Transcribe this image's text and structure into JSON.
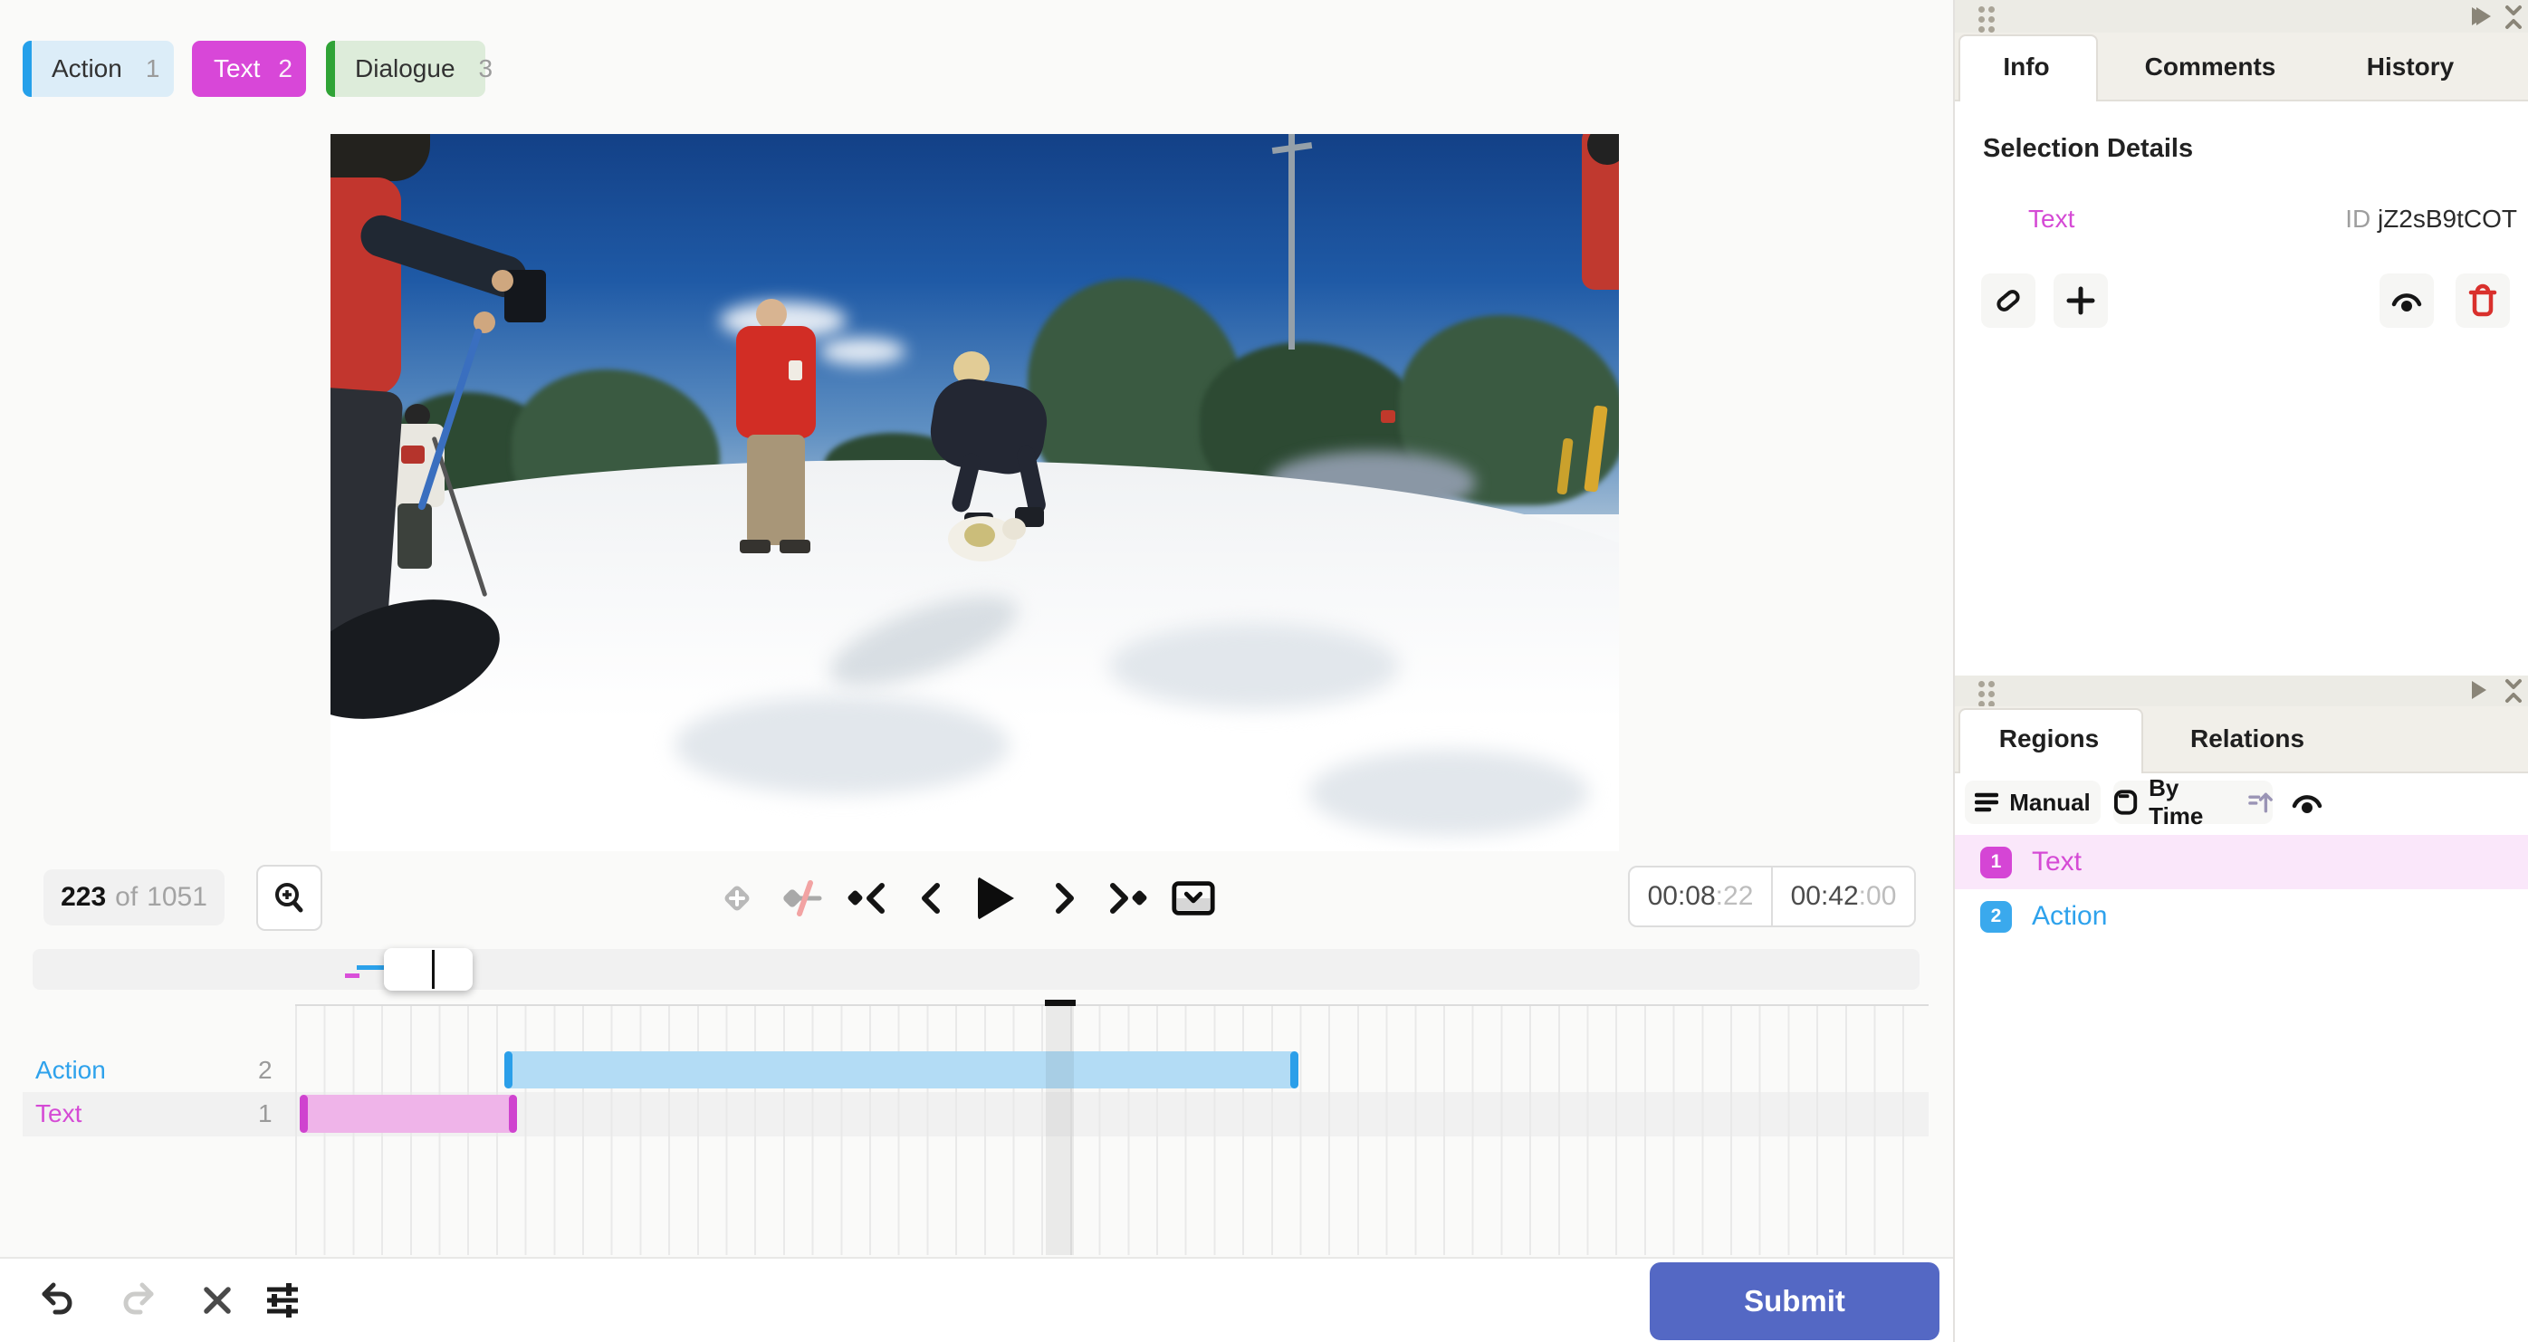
{
  "labels": [
    {
      "name": "Action",
      "hotkey": "1",
      "color": "#25a0ea",
      "bg": "#dcedf8"
    },
    {
      "name": "Text",
      "hotkey": "2",
      "color": "#d847d8",
      "bg": "#d847d8",
      "selected": true
    },
    {
      "name": "Dialogue",
      "hotkey": "3",
      "color": "#2fa336",
      "bg": "#ddecda"
    }
  ],
  "player": {
    "frame_current": "223",
    "frame_separator": "of",
    "frame_total": "1051",
    "time_current": {
      "main": "00:08",
      "frames": ":22"
    },
    "time_total": {
      "main": "00:42",
      "frames": ":00"
    }
  },
  "info_panel": {
    "tabs": [
      {
        "label": "Info"
      },
      {
        "label": "Comments"
      },
      {
        "label": "History"
      }
    ],
    "active_tab": "Info",
    "section_title": "Selection Details",
    "selection_label": "Text",
    "id_label": "ID",
    "id_value": "jZ2sB9tCOT"
  },
  "regions_panel": {
    "tabs": [
      {
        "label": "Regions"
      },
      {
        "label": "Relations"
      }
    ],
    "active_tab": "Regions",
    "group_button": "Manual",
    "sort_button": "By Time",
    "regions": [
      {
        "index": "1",
        "label": "Text",
        "color": "#d545d5",
        "row_bg": "#fae7fa"
      },
      {
        "index": "2",
        "label": "Action",
        "color": "#2ea2ec",
        "row_bg": "#ffffff"
      }
    ]
  },
  "timeline": {
    "tracks": [
      {
        "label": "Action",
        "count": "2",
        "color": "#2ea2ec"
      },
      {
        "label": "Text",
        "count": "1",
        "color": "#d54ad5",
        "selected": true
      }
    ]
  },
  "footer": {
    "submit_label": "Submit"
  },
  "colors": {
    "blue_accent": "#2aa2ec",
    "magenta_accent": "#d545d5",
    "green_accent": "#2fa336",
    "submit_button": "#5468c4",
    "trash_red": "#d9302c",
    "panel_header_bg": "#ecebe5",
    "region_bar_blue": "#b3dcf5",
    "region_bar_pink": "#efb4e9"
  },
  "icons": {
    "zoom_in": "magnifier-plus",
    "add_keyframe": "diamond-plus",
    "toggle_interpolation": "diamond-slash",
    "prev_keyframe": "diamond-chevron-left",
    "prev_frame": "chevron-left",
    "play": "triangle-right",
    "next_frame": "chevron-right",
    "next_keyframe": "chevron-right-diamond",
    "toggle_timeline": "box-chevron-down",
    "undo": "arrow-undo",
    "redo": "arrow-redo",
    "clear": "x-cross",
    "settings": "sliders",
    "link": "chain",
    "add_relation": "plus",
    "visibility": "eye",
    "delete": "trash",
    "drag_handle": "six-dots",
    "expand_panel": "play-triangle",
    "collapse_panel": "double-chevron",
    "group_manual": "hamburger",
    "order_by_time": "card",
    "sort_ascending": "lines-up-arrow"
  }
}
